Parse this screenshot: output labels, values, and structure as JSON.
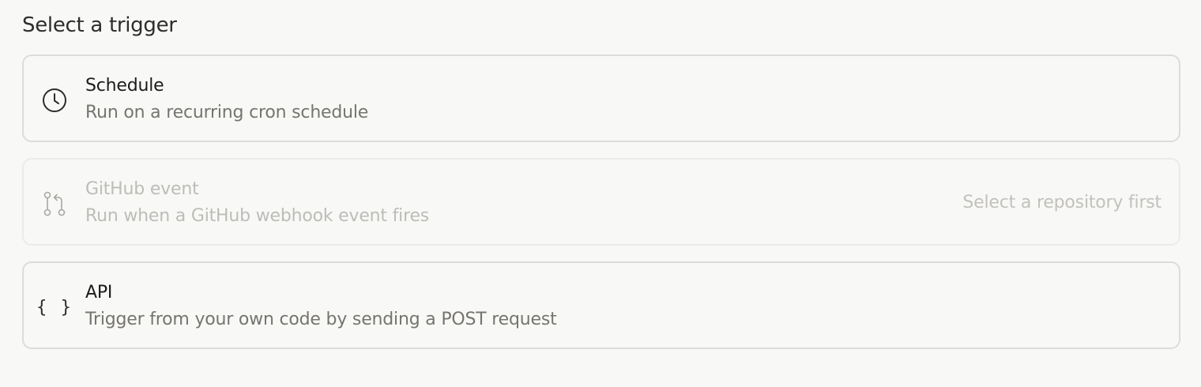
{
  "page": {
    "heading": "Select a trigger"
  },
  "triggers": [
    {
      "id": "schedule",
      "icon": "clock-icon",
      "title": "Schedule",
      "description": "Run on a recurring cron schedule",
      "disabled": false
    },
    {
      "id": "github",
      "icon": "git-pull-request-icon",
      "title": "GitHub event",
      "description": "Run when a GitHub webhook event fires",
      "hint": "Select a repository first",
      "disabled": true
    },
    {
      "id": "api",
      "icon": "code-braces-icon",
      "icon_glyph": "{ }",
      "title": "API",
      "description": "Trigger from your own code by sending a POST request",
      "disabled": false
    }
  ],
  "colors": {
    "background": "#f8f8f6",
    "border": "#dcdcd9",
    "border_disabled": "#ebebe8",
    "text_primary": "#1c1c1a",
    "text_secondary": "#76746f",
    "text_disabled": "#bdbcb8"
  }
}
